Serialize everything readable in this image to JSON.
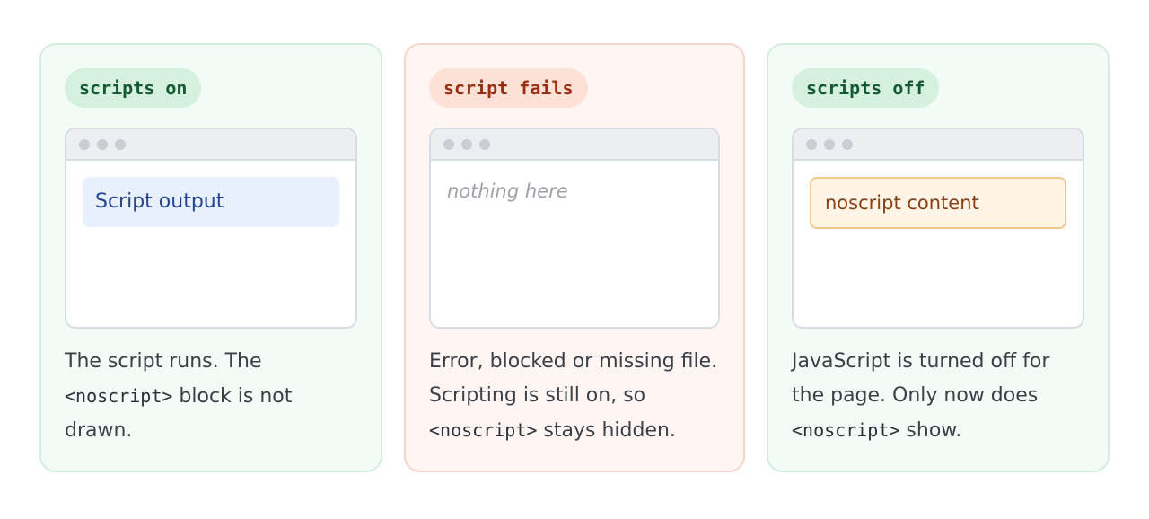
{
  "panels": [
    {
      "label": "scripts on",
      "window_content": "Script output",
      "description_before": "The script runs. The ",
      "description_code": "<noscript>",
      "description_after": " block is not drawn."
    },
    {
      "label": "script fails",
      "window_content": "nothing here",
      "description_before": "Error, blocked or missing file. Scripting is still on, so ",
      "description_code": "<noscript>",
      "description_after": " stays hidden."
    },
    {
      "label": "scripts off",
      "window_content": "noscript content",
      "description_before": "JavaScript is turned off for the page. Only now does ",
      "description_code": "<noscript>",
      "description_after": " show."
    }
  ],
  "colors": {
    "green_panel_bg": "#f2fbf5",
    "red_panel_bg": "#fff5f3",
    "script_output_bg": "#e8f0fd",
    "noscript_bg": "#fff4e5",
    "noscript_border": "#f0c988"
  }
}
